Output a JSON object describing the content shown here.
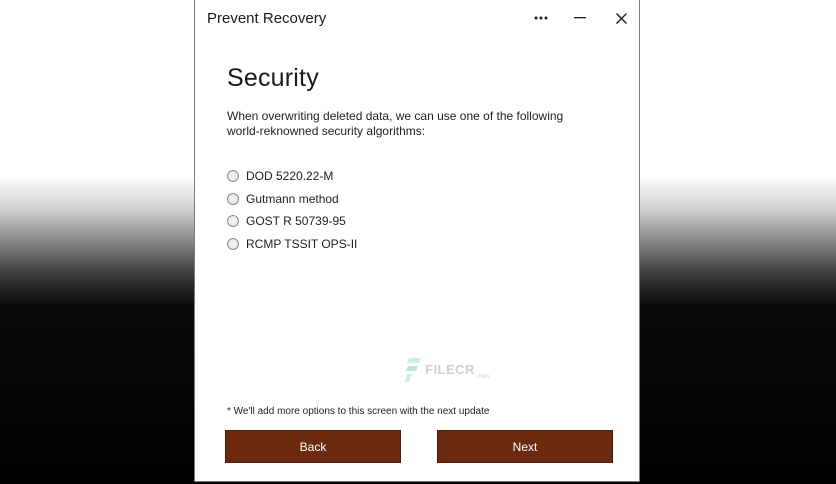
{
  "window": {
    "title": "Prevent Recovery"
  },
  "titlebar_icons": {
    "more": "more-horizontal-icon",
    "minimize": "minimize-icon",
    "close": "close-icon"
  },
  "page": {
    "title": "Security",
    "description": "When overwriting deleted data, we can use one of the following world-reknowned security algorithms:"
  },
  "options": [
    {
      "label": "DOD 5220.22-M",
      "selected": false
    },
    {
      "label": "Gutmann method",
      "selected": false
    },
    {
      "label": "GOST R 50739-95",
      "selected": false
    },
    {
      "label": "RCMP TSSIT OPS-II",
      "selected": false
    }
  ],
  "watermark": {
    "text": "FILECR",
    "suffix": ".com"
  },
  "footnote": "* We'll add more options to this screen with the next update",
  "buttons": {
    "back": "Back",
    "next": "Next"
  },
  "colors": {
    "button_bg": "#6b2a0f",
    "button_text": "#ffffff",
    "window_bg": "#ffffff"
  }
}
